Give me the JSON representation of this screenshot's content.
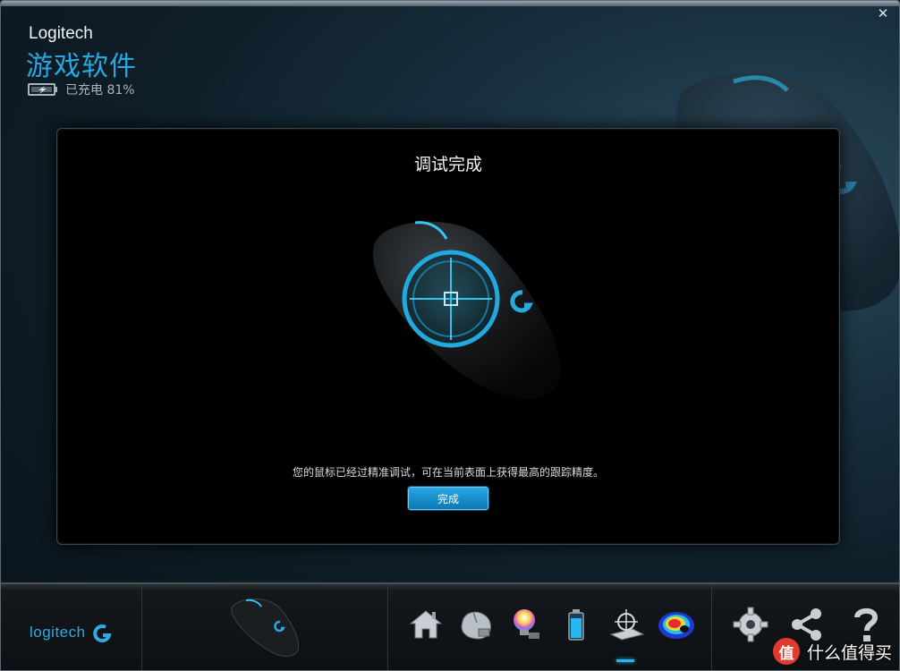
{
  "window": {
    "brand": "Logitech",
    "app_title": "游戏软件",
    "battery_text": "已充电 81%",
    "close_label": "✕"
  },
  "panel": {
    "title": "调试完成",
    "message": "您的鼠标已经过精准调试，可在当前表面上获得最高的跟踪精度。",
    "done_label": "完成"
  },
  "bottom_bar": {
    "logo_text": "logitech",
    "tools": [
      {
        "icon": "home-icon"
      },
      {
        "icon": "mouse-settings-icon"
      },
      {
        "icon": "lighting-icon"
      },
      {
        "icon": "battery-icon"
      },
      {
        "icon": "surface-tuning-icon",
        "active": true
      },
      {
        "icon": "heatmap-icon"
      },
      {
        "icon": "gear-icon"
      },
      {
        "icon": "share-icon"
      },
      {
        "icon": "help-icon"
      }
    ]
  },
  "watermark": {
    "badge": "值",
    "text": "什么值得买"
  },
  "colors": {
    "accent": "#28a8e0",
    "button": "#1a8fcd",
    "watermark_red": "#e33a2f"
  }
}
